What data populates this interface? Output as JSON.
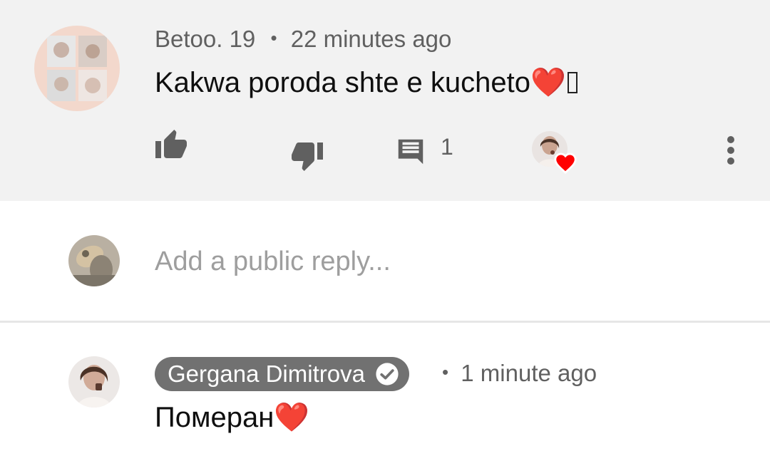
{
  "comment": {
    "author": "Betoo. 19",
    "separator": "•",
    "time": "22 minutes ago",
    "text": "Kakwa poroda shte e kucheto",
    "emoji": "❤️",
    "reply_count": "1",
    "icons": {
      "like": "thumb-up-icon",
      "dislike": "thumb-down-icon",
      "reply": "comment-icon",
      "creator_heart": "heart-icon",
      "more": "more-vert-icon"
    },
    "colors": {
      "background": "#f2f2f2",
      "heart": "#ff0000"
    }
  },
  "reply_box": {
    "placeholder": "Add a public reply..."
  },
  "reply": {
    "channel_name": "Gergana Dimitrova",
    "separator": "•",
    "time": "1 minute ago",
    "text": "Померан",
    "emoji": "❤️",
    "icons": {
      "verified": "verified-check-icon"
    },
    "colors": {
      "badge_background": "#717171"
    }
  }
}
